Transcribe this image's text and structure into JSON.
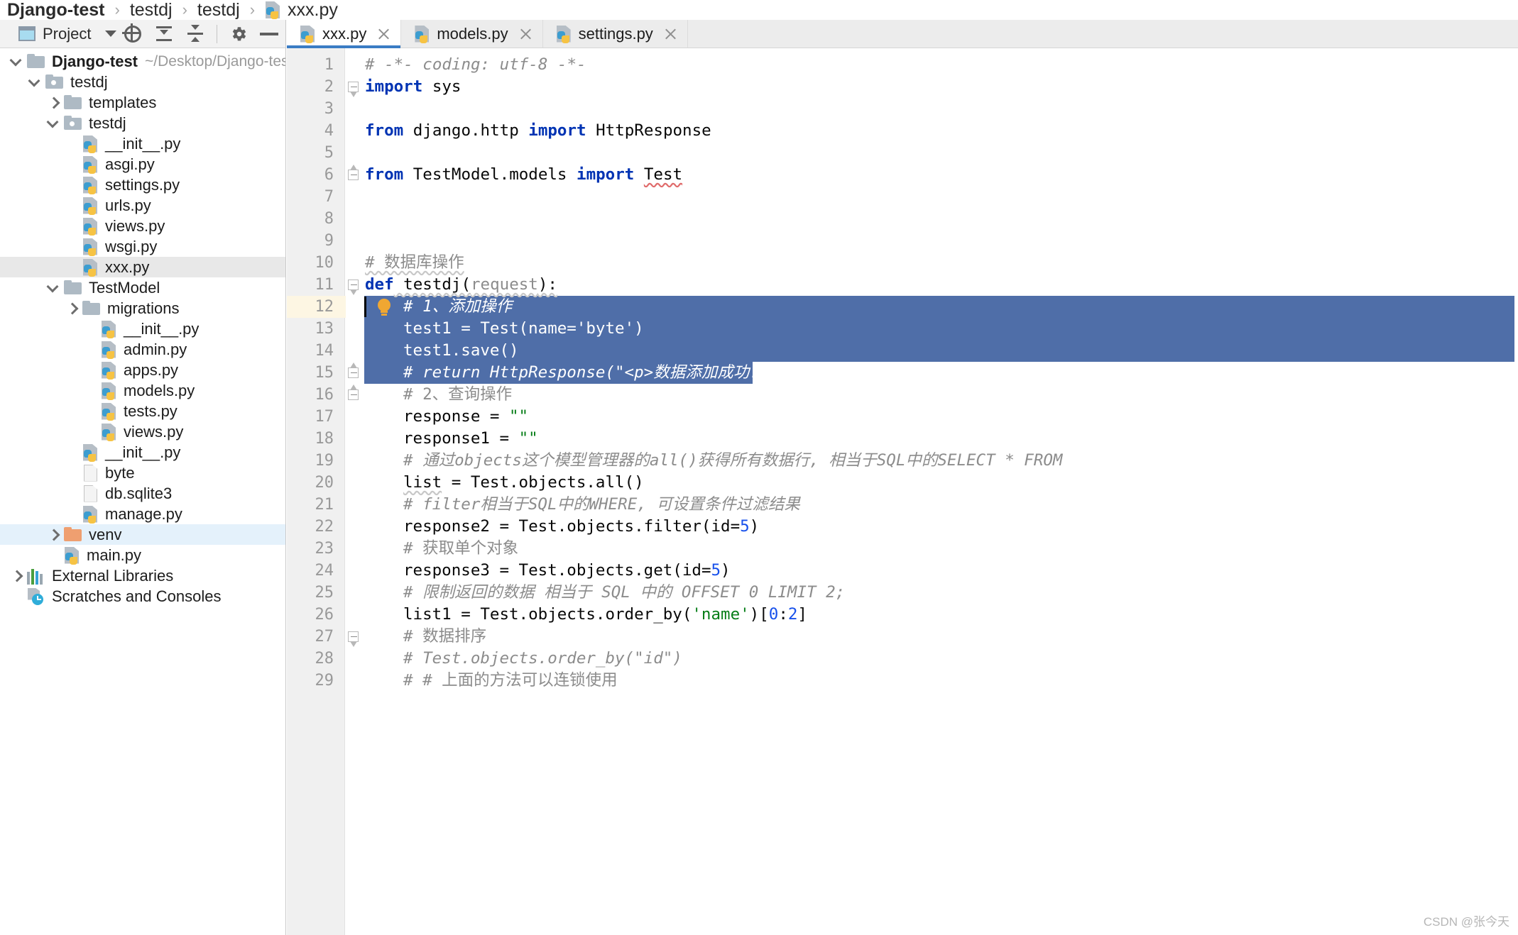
{
  "breadcrumb": {
    "items": [
      {
        "label": "Django-test",
        "bold": true,
        "icon": "none"
      },
      {
        "label": "testdj",
        "bold": false,
        "icon": "none"
      },
      {
        "label": "testdj",
        "bold": false,
        "icon": "none"
      },
      {
        "label": "xxx.py",
        "bold": false,
        "icon": "python-file-icon"
      }
    ],
    "separator": "›"
  },
  "project_panel": {
    "title": "Project",
    "toolbar_icons": [
      "select-opened-file-icon",
      "collapse-all-icon",
      "expand-all-icon",
      "settings-gear-icon",
      "hide-panel-icon"
    ],
    "tree": [
      {
        "label": "Django-test",
        "path": "~/Desktop/Django-test",
        "icon": "folder-icon",
        "twist": "down",
        "indent": 0,
        "bold": true,
        "highlight": "none"
      },
      {
        "label": "testdj",
        "path": "",
        "icon": "folder-module-icon",
        "twist": "down",
        "indent": 1,
        "bold": false,
        "highlight": "none"
      },
      {
        "label": "templates",
        "path": "",
        "icon": "folder-icon",
        "twist": "right",
        "indent": 2,
        "bold": false,
        "highlight": "none"
      },
      {
        "label": "testdj",
        "path": "",
        "icon": "folder-module-icon",
        "twist": "down",
        "indent": 2,
        "bold": false,
        "highlight": "none"
      },
      {
        "label": "__init__.py",
        "path": "",
        "icon": "python-file-icon",
        "twist": "none",
        "indent": 3,
        "bold": false,
        "highlight": "none"
      },
      {
        "label": "asgi.py",
        "path": "",
        "icon": "python-file-icon",
        "twist": "none",
        "indent": 3,
        "bold": false,
        "highlight": "none"
      },
      {
        "label": "settings.py",
        "path": "",
        "icon": "python-file-icon",
        "twist": "none",
        "indent": 3,
        "bold": false,
        "highlight": "none"
      },
      {
        "label": "urls.py",
        "path": "",
        "icon": "python-file-icon",
        "twist": "none",
        "indent": 3,
        "bold": false,
        "highlight": "none"
      },
      {
        "label": "views.py",
        "path": "",
        "icon": "python-file-icon",
        "twist": "none",
        "indent": 3,
        "bold": false,
        "highlight": "none"
      },
      {
        "label": "wsgi.py",
        "path": "",
        "icon": "python-file-icon",
        "twist": "none",
        "indent": 3,
        "bold": false,
        "highlight": "none"
      },
      {
        "label": "xxx.py",
        "path": "",
        "icon": "python-file-icon",
        "twist": "none",
        "indent": 3,
        "bold": false,
        "highlight": "gray"
      },
      {
        "label": "TestModel",
        "path": "",
        "icon": "folder-icon",
        "twist": "down",
        "indent": 2,
        "bold": false,
        "highlight": "none"
      },
      {
        "label": "migrations",
        "path": "",
        "icon": "folder-icon",
        "twist": "right",
        "indent": 3,
        "bold": false,
        "highlight": "none"
      },
      {
        "label": "__init__.py",
        "path": "",
        "icon": "python-file-icon",
        "twist": "none",
        "indent": 4,
        "bold": false,
        "highlight": "none"
      },
      {
        "label": "admin.py",
        "path": "",
        "icon": "python-file-icon",
        "twist": "none",
        "indent": 4,
        "bold": false,
        "highlight": "none"
      },
      {
        "label": "apps.py",
        "path": "",
        "icon": "python-file-icon",
        "twist": "none",
        "indent": 4,
        "bold": false,
        "highlight": "none"
      },
      {
        "label": "models.py",
        "path": "",
        "icon": "python-file-icon",
        "twist": "none",
        "indent": 4,
        "bold": false,
        "highlight": "none"
      },
      {
        "label": "tests.py",
        "path": "",
        "icon": "python-file-icon",
        "twist": "none",
        "indent": 4,
        "bold": false,
        "highlight": "none"
      },
      {
        "label": "views.py",
        "path": "",
        "icon": "python-file-icon",
        "twist": "none",
        "indent": 4,
        "bold": false,
        "highlight": "none"
      },
      {
        "label": "__init__.py",
        "path": "",
        "icon": "python-file-icon",
        "twist": "none",
        "indent": 3,
        "bold": false,
        "highlight": "none"
      },
      {
        "label": "byte",
        "path": "",
        "icon": "generic-file-icon",
        "twist": "none",
        "indent": 3,
        "bold": false,
        "highlight": "none"
      },
      {
        "label": "db.sqlite3",
        "path": "",
        "icon": "generic-file-icon",
        "twist": "none",
        "indent": 3,
        "bold": false,
        "highlight": "none"
      },
      {
        "label": "manage.py",
        "path": "",
        "icon": "python-file-icon",
        "twist": "none",
        "indent": 3,
        "bold": false,
        "highlight": "none"
      },
      {
        "label": "venv",
        "path": "",
        "icon": "folder-orange-icon",
        "twist": "right",
        "indent": 2,
        "bold": false,
        "highlight": "blue"
      },
      {
        "label": "main.py",
        "path": "",
        "icon": "python-file-icon",
        "twist": "none",
        "indent": 2,
        "bold": false,
        "highlight": "none"
      },
      {
        "label": "External Libraries",
        "path": "",
        "icon": "external-libraries-icon",
        "twist": "right",
        "indent": 0,
        "bold": false,
        "highlight": "none"
      },
      {
        "label": "Scratches and Consoles",
        "path": "",
        "icon": "scratches-icon",
        "twist": "none",
        "indent": 0,
        "bold": false,
        "highlight": "none"
      }
    ]
  },
  "editor": {
    "tabs": [
      {
        "label": "xxx.py",
        "icon": "python-file-icon",
        "active": true
      },
      {
        "label": "models.py",
        "icon": "python-file-icon",
        "active": false
      },
      {
        "label": "settings.py",
        "icon": "python-file-icon",
        "active": false
      }
    ],
    "filename": "xxx.py",
    "selection_color": "#4f6ea8",
    "current_line": 12,
    "caret_line": 12,
    "selected_lines": [
      12,
      13,
      14,
      15
    ],
    "code": [
      {
        "n": 1,
        "fold": "none",
        "tokens": [
          {
            "t": "# -*- coding: utf-8 -*-",
            "c": "cmt"
          }
        ]
      },
      {
        "n": 2,
        "fold": "start",
        "tokens": [
          {
            "t": "import",
            "c": "kw"
          },
          {
            "t": " sys",
            "c": "plain"
          }
        ]
      },
      {
        "n": 3,
        "fold": "none",
        "tokens": []
      },
      {
        "n": 4,
        "fold": "none",
        "tokens": [
          {
            "t": "from",
            "c": "kw"
          },
          {
            "t": " django.http ",
            "c": "plain"
          },
          {
            "t": "import",
            "c": "kw"
          },
          {
            "t": " HttpResponse",
            "c": "plain"
          }
        ]
      },
      {
        "n": 5,
        "fold": "none",
        "tokens": []
      },
      {
        "n": 6,
        "fold": "end",
        "tokens": [
          {
            "t": "from",
            "c": "kw"
          },
          {
            "t": " TestModel.models ",
            "c": "plain"
          },
          {
            "t": "import",
            "c": "kw"
          },
          {
            "t": " ",
            "c": "plain"
          },
          {
            "t": "Test",
            "c": "squig-r"
          }
        ]
      },
      {
        "n": 7,
        "fold": "none",
        "tokens": []
      },
      {
        "n": 8,
        "fold": "none",
        "tokens": []
      },
      {
        "n": 9,
        "fold": "none",
        "tokens": []
      },
      {
        "n": 10,
        "fold": "none",
        "tokens": [
          {
            "t": "# 数据库操作",
            "c": "cmt-n squig"
          }
        ]
      },
      {
        "n": 11,
        "fold": "start",
        "tokens": [
          {
            "t": "def",
            "c": "kw"
          },
          {
            "t": " testdj(",
            "c": "plain squig"
          },
          {
            "t": "request",
            "c": "param squig"
          },
          {
            "t": "):",
            "c": "plain squig"
          }
        ]
      },
      {
        "n": 12,
        "fold": "none",
        "indent": 4,
        "tokens": [
          {
            "t": "# 1、添加操作",
            "c": "cmt"
          }
        ]
      },
      {
        "n": 13,
        "fold": "none",
        "indent": 4,
        "tokens": [
          {
            "t": "test1 = Test(name=",
            "c": "plain"
          },
          {
            "t": "'byte'",
            "c": "str"
          },
          {
            "t": ")",
            "c": "plain"
          }
        ]
      },
      {
        "n": 14,
        "fold": "none",
        "indent": 4,
        "tokens": [
          {
            "t": "test1.save()",
            "c": "plain"
          }
        ]
      },
      {
        "n": 15,
        "fold": "end",
        "indent": 4,
        "tokens": [
          {
            "t": "# return HttpResponse(\"<p>数据添加成功! </p>\")",
            "c": "cmt"
          }
        ]
      },
      {
        "n": 16,
        "fold": "end",
        "indent": 4,
        "tokens": [
          {
            "t": "# 2、查询操作",
            "c": "cmt-n"
          }
        ]
      },
      {
        "n": 17,
        "fold": "none",
        "indent": 4,
        "tokens": [
          {
            "t": "response = ",
            "c": "plain"
          },
          {
            "t": "\"\"",
            "c": "str"
          }
        ]
      },
      {
        "n": 18,
        "fold": "none",
        "indent": 4,
        "tokens": [
          {
            "t": "response1 = ",
            "c": "plain"
          },
          {
            "t": "\"\"",
            "c": "str"
          }
        ]
      },
      {
        "n": 19,
        "fold": "none",
        "indent": 4,
        "tokens": [
          {
            "t": "# 通过objects这个模型管理器的all()获得所有数据行, 相当于SQL中的SELECT * FROM",
            "c": "cmt"
          }
        ]
      },
      {
        "n": 20,
        "fold": "none",
        "indent": 4,
        "tokens": [
          {
            "t": "list",
            "c": "plain squig"
          },
          {
            "t": " = Test.objects.all()",
            "c": "plain"
          }
        ]
      },
      {
        "n": 21,
        "fold": "none",
        "indent": 4,
        "tokens": [
          {
            "t": "# filter相当于SQL中的WHERE, 可设置条件过滤结果",
            "c": "cmt"
          }
        ]
      },
      {
        "n": 22,
        "fold": "none",
        "indent": 4,
        "tokens": [
          {
            "t": "response2 = Test.objects.filter(",
            "c": "plain"
          },
          {
            "t": "id",
            "c": "plain"
          },
          {
            "t": "=",
            "c": "plain"
          },
          {
            "t": "5",
            "c": "num"
          },
          {
            "t": ")",
            "c": "plain"
          }
        ]
      },
      {
        "n": 23,
        "fold": "none",
        "indent": 4,
        "tokens": [
          {
            "t": "# 获取单个对象",
            "c": "cmt-n"
          }
        ]
      },
      {
        "n": 24,
        "fold": "none",
        "indent": 4,
        "tokens": [
          {
            "t": "response3 = Test.objects.get(",
            "c": "plain"
          },
          {
            "t": "id",
            "c": "plain"
          },
          {
            "t": "=",
            "c": "plain"
          },
          {
            "t": "5",
            "c": "num"
          },
          {
            "t": ")",
            "c": "plain"
          }
        ]
      },
      {
        "n": 25,
        "fold": "none",
        "indent": 4,
        "tokens": [
          {
            "t": "# 限制返回的数据 相当于 SQL 中的 OFFSET 0 LIMIT 2;",
            "c": "cmt"
          }
        ]
      },
      {
        "n": 26,
        "fold": "none",
        "indent": 4,
        "tokens": [
          {
            "t": "list1 = Test.objects.order_by(",
            "c": "plain"
          },
          {
            "t": "'name'",
            "c": "str"
          },
          {
            "t": ")[",
            "c": "plain"
          },
          {
            "t": "0",
            "c": "num"
          },
          {
            "t": ":",
            "c": "plain"
          },
          {
            "t": "2",
            "c": "num"
          },
          {
            "t": "]",
            "c": "plain"
          }
        ]
      },
      {
        "n": 27,
        "fold": "start",
        "indent": 4,
        "tokens": [
          {
            "t": "# 数据排序",
            "c": "cmt-n"
          }
        ]
      },
      {
        "n": 28,
        "fold": "none",
        "indent": 4,
        "tokens": [
          {
            "t": "# Test.objects.order_by(\"id\")",
            "c": "cmt"
          }
        ]
      },
      {
        "n": 29,
        "fold": "none",
        "indent": 4,
        "tokens": [
          {
            "t": "# # 上面的方法可以连锁使用",
            "c": "cmt-n"
          }
        ]
      }
    ]
  },
  "watermark": "CSDN @张今天"
}
